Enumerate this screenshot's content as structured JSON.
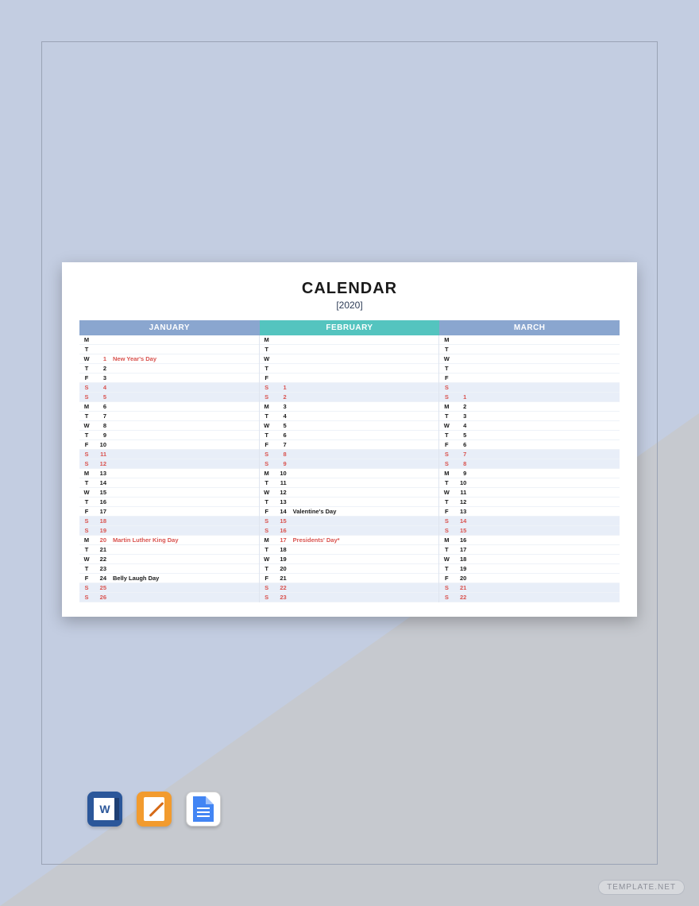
{
  "title": "CALENDAR",
  "year": "[2020]",
  "watermark": "TEMPLATE.NET",
  "months": [
    {
      "name": "JANUARY",
      "headerClass": "hdr-jan",
      "rows": [
        {
          "dow": "M",
          "num": "",
          "event": "",
          "weekend": false
        },
        {
          "dow": "T",
          "num": "",
          "event": "",
          "weekend": false
        },
        {
          "dow": "W",
          "num": "1",
          "event": "New Year's Day",
          "weekend": false,
          "holiday": true
        },
        {
          "dow": "T",
          "num": "2",
          "event": "",
          "weekend": false
        },
        {
          "dow": "F",
          "num": "3",
          "event": "",
          "weekend": false
        },
        {
          "dow": "S",
          "num": "4",
          "event": "",
          "weekend": true
        },
        {
          "dow": "S",
          "num": "5",
          "event": "",
          "weekend": true
        },
        {
          "dow": "M",
          "num": "6",
          "event": "",
          "weekend": false
        },
        {
          "dow": "T",
          "num": "7",
          "event": "",
          "weekend": false
        },
        {
          "dow": "W",
          "num": "8",
          "event": "",
          "weekend": false
        },
        {
          "dow": "T",
          "num": "9",
          "event": "",
          "weekend": false
        },
        {
          "dow": "F",
          "num": "10",
          "event": "",
          "weekend": false
        },
        {
          "dow": "S",
          "num": "11",
          "event": "",
          "weekend": true
        },
        {
          "dow": "S",
          "num": "12",
          "event": "",
          "weekend": true
        },
        {
          "dow": "M",
          "num": "13",
          "event": "",
          "weekend": false
        },
        {
          "dow": "T",
          "num": "14",
          "event": "",
          "weekend": false
        },
        {
          "dow": "W",
          "num": "15",
          "event": "",
          "weekend": false
        },
        {
          "dow": "T",
          "num": "16",
          "event": "",
          "weekend": false
        },
        {
          "dow": "F",
          "num": "17",
          "event": "",
          "weekend": false
        },
        {
          "dow": "S",
          "num": "18",
          "event": "",
          "weekend": true
        },
        {
          "dow": "S",
          "num": "19",
          "event": "",
          "weekend": true
        },
        {
          "dow": "M",
          "num": "20",
          "event": "Martin Luther King Day",
          "weekend": false,
          "holiday": true
        },
        {
          "dow": "T",
          "num": "21",
          "event": "",
          "weekend": false
        },
        {
          "dow": "W",
          "num": "22",
          "event": "",
          "weekend": false
        },
        {
          "dow": "T",
          "num": "23",
          "event": "",
          "weekend": false
        },
        {
          "dow": "F",
          "num": "24",
          "event": "Belly Laugh Day",
          "weekend": false
        },
        {
          "dow": "S",
          "num": "25",
          "event": "",
          "weekend": true
        },
        {
          "dow": "S",
          "num": "26",
          "event": "",
          "weekend": true
        }
      ]
    },
    {
      "name": "FEBRUARY",
      "headerClass": "hdr-feb",
      "rows": [
        {
          "dow": "M",
          "num": "",
          "event": "",
          "weekend": false
        },
        {
          "dow": "T",
          "num": "",
          "event": "",
          "weekend": false
        },
        {
          "dow": "W",
          "num": "",
          "event": "",
          "weekend": false
        },
        {
          "dow": "T",
          "num": "",
          "event": "",
          "weekend": false
        },
        {
          "dow": "F",
          "num": "",
          "event": "",
          "weekend": false
        },
        {
          "dow": "S",
          "num": "1",
          "event": "",
          "weekend": true
        },
        {
          "dow": "S",
          "num": "2",
          "event": "",
          "weekend": true
        },
        {
          "dow": "M",
          "num": "3",
          "event": "",
          "weekend": false
        },
        {
          "dow": "T",
          "num": "4",
          "event": "",
          "weekend": false
        },
        {
          "dow": "W",
          "num": "5",
          "event": "",
          "weekend": false
        },
        {
          "dow": "T",
          "num": "6",
          "event": "",
          "weekend": false
        },
        {
          "dow": "F",
          "num": "7",
          "event": "",
          "weekend": false
        },
        {
          "dow": "S",
          "num": "8",
          "event": "",
          "weekend": true
        },
        {
          "dow": "S",
          "num": "9",
          "event": "",
          "weekend": true
        },
        {
          "dow": "M",
          "num": "10",
          "event": "",
          "weekend": false
        },
        {
          "dow": "T",
          "num": "11",
          "event": "",
          "weekend": false
        },
        {
          "dow": "W",
          "num": "12",
          "event": "",
          "weekend": false
        },
        {
          "dow": "T",
          "num": "13",
          "event": "",
          "weekend": false
        },
        {
          "dow": "F",
          "num": "14",
          "event": "Valentine's Day",
          "weekend": false
        },
        {
          "dow": "S",
          "num": "15",
          "event": "",
          "weekend": true
        },
        {
          "dow": "S",
          "num": "16",
          "event": "",
          "weekend": true
        },
        {
          "dow": "M",
          "num": "17",
          "event": "Presidents' Day*",
          "weekend": false,
          "holiday": true
        },
        {
          "dow": "T",
          "num": "18",
          "event": "",
          "weekend": false
        },
        {
          "dow": "W",
          "num": "19",
          "event": "",
          "weekend": false
        },
        {
          "dow": "T",
          "num": "20",
          "event": "",
          "weekend": false
        },
        {
          "dow": "F",
          "num": "21",
          "event": "",
          "weekend": false
        },
        {
          "dow": "S",
          "num": "22",
          "event": "",
          "weekend": true
        },
        {
          "dow": "S",
          "num": "23",
          "event": "",
          "weekend": true
        }
      ]
    },
    {
      "name": "MARCH",
      "headerClass": "hdr-mar",
      "rows": [
        {
          "dow": "M",
          "num": "",
          "event": "",
          "weekend": false
        },
        {
          "dow": "T",
          "num": "",
          "event": "",
          "weekend": false
        },
        {
          "dow": "W",
          "num": "",
          "event": "",
          "weekend": false
        },
        {
          "dow": "T",
          "num": "",
          "event": "",
          "weekend": false
        },
        {
          "dow": "F",
          "num": "",
          "event": "",
          "weekend": false
        },
        {
          "dow": "S",
          "num": "",
          "event": "",
          "weekend": true
        },
        {
          "dow": "S",
          "num": "1",
          "event": "",
          "weekend": true
        },
        {
          "dow": "M",
          "num": "2",
          "event": "",
          "weekend": false
        },
        {
          "dow": "T",
          "num": "3",
          "event": "",
          "weekend": false
        },
        {
          "dow": "W",
          "num": "4",
          "event": "",
          "weekend": false
        },
        {
          "dow": "T",
          "num": "5",
          "event": "",
          "weekend": false
        },
        {
          "dow": "F",
          "num": "6",
          "event": "",
          "weekend": false
        },
        {
          "dow": "S",
          "num": "7",
          "event": "",
          "weekend": true
        },
        {
          "dow": "S",
          "num": "8",
          "event": "",
          "weekend": true
        },
        {
          "dow": "M",
          "num": "9",
          "event": "",
          "weekend": false
        },
        {
          "dow": "T",
          "num": "10",
          "event": "",
          "weekend": false
        },
        {
          "dow": "W",
          "num": "11",
          "event": "",
          "weekend": false
        },
        {
          "dow": "T",
          "num": "12",
          "event": "",
          "weekend": false
        },
        {
          "dow": "F",
          "num": "13",
          "event": "",
          "weekend": false
        },
        {
          "dow": "S",
          "num": "14",
          "event": "",
          "weekend": true
        },
        {
          "dow": "S",
          "num": "15",
          "event": "",
          "weekend": true
        },
        {
          "dow": "M",
          "num": "16",
          "event": "",
          "weekend": false
        },
        {
          "dow": "T",
          "num": "17",
          "event": "",
          "weekend": false
        },
        {
          "dow": "W",
          "num": "18",
          "event": "",
          "weekend": false
        },
        {
          "dow": "T",
          "num": "19",
          "event": "",
          "weekend": false
        },
        {
          "dow": "F",
          "num": "20",
          "event": "",
          "weekend": false
        },
        {
          "dow": "S",
          "num": "21",
          "event": "",
          "weekend": true
        },
        {
          "dow": "S",
          "num": "22",
          "event": "",
          "weekend": true
        }
      ]
    }
  ]
}
